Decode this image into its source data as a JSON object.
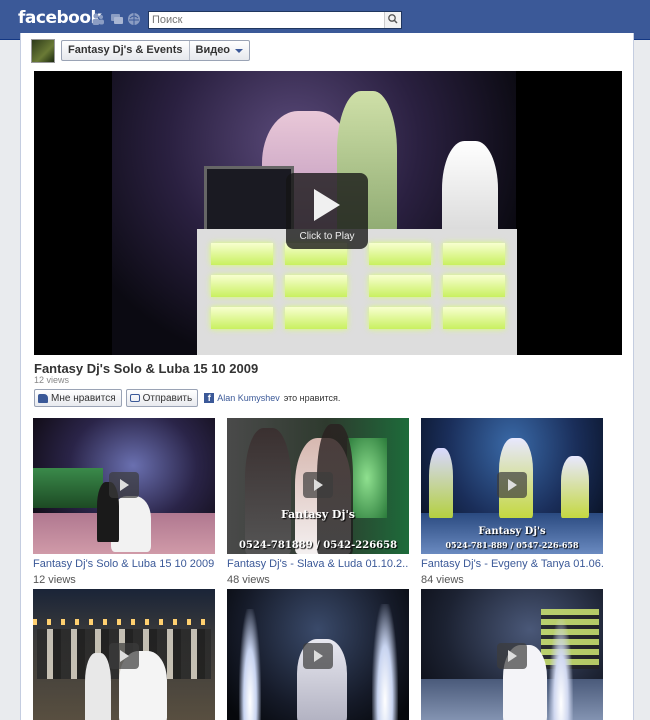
{
  "header": {
    "logo": "facebook",
    "search_placeholder": "Поиск",
    "jewels": [
      "friends-icon",
      "messages-icon",
      "notifications-icon"
    ],
    "brand_color": "#3b5998"
  },
  "page": {
    "name": "Fantasy Dj's & Events",
    "section": "Видео"
  },
  "player": {
    "play_label": "Click to Play"
  },
  "video": {
    "title": "Fantasy Dj's Solo & Luba 15 10 2009",
    "views": "12 views"
  },
  "actions": {
    "like": "Мне нравится",
    "send": "Отправить",
    "liker": "Alan Kumyshev",
    "liker_suffix": "это нравится."
  },
  "grid": [
    {
      "title": "Fantasy Dj's Solo & Luba 15 10 2009",
      "views": "12 views",
      "watermark": ""
    },
    {
      "title": "Fantasy Dj's - Slava & Luda 01.10.2...",
      "views": "48 views",
      "watermark": "Fantasy Dj's",
      "phone": "0524-781889 / 0542-226658"
    },
    {
      "title": "Fantasy Dj's - Evgeny & Tanya 01.06...",
      "views": "84 views",
      "watermark": "Fantasy Dj's",
      "phone": "0524-781-889 / 0547-226-658"
    },
    {
      "title": "",
      "views": "",
      "watermark": ""
    },
    {
      "title": "",
      "views": "",
      "watermark": ""
    },
    {
      "title": "",
      "views": "",
      "watermark": ""
    }
  ]
}
